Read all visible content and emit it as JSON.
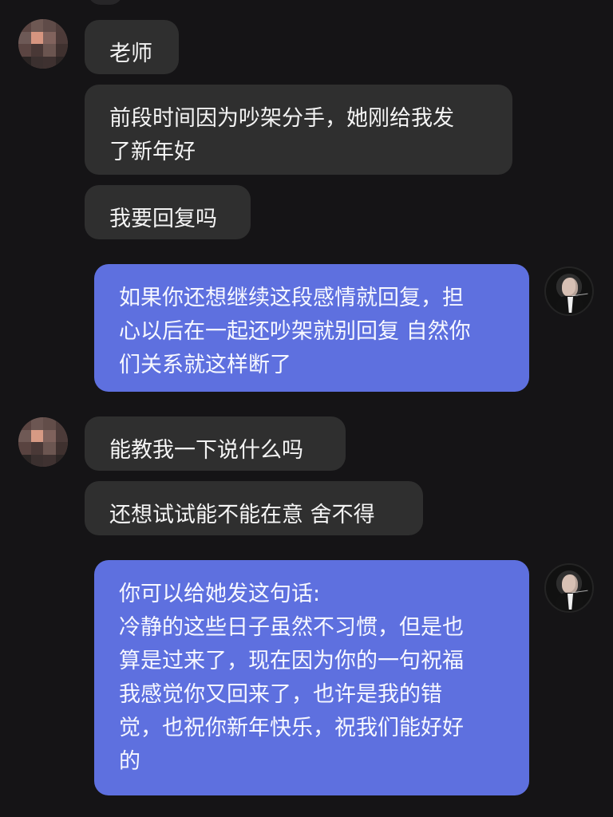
{
  "messages": [
    {
      "side": "incoming",
      "text": "老师"
    },
    {
      "side": "incoming",
      "text": "前段时间因为吵架分手，她刚给我发\n了新年好"
    },
    {
      "side": "incoming",
      "text": "我要回复吗"
    },
    {
      "side": "outgoing",
      "text": "如果你还想继续这段感情就回复，担\n心以后在一起还吵架就别回复 自然你\n们关系就这样断了"
    },
    {
      "side": "incoming",
      "text": "能教我一下说什么吗"
    },
    {
      "side": "incoming",
      "text": "还想试试能不能在意 舍不得"
    },
    {
      "side": "outgoing",
      "text": "你可以给她发这句话:\n冷静的这些日子虽然不习惯，但是也\n算是过来了，现在因为你的一句祝福\n我感觉你又回来了，也许是我的错\n觉，也祝你新年快乐，祝我们能好好\n的"
    }
  ],
  "avatars": {
    "incoming": "pixelated-user-avatar",
    "outgoing": "teacher-avatar"
  },
  "colors": {
    "background": "#151416",
    "incoming_bubble": "#2f2f2f",
    "outgoing_bubble": "#5e70df",
    "text": "#f4f4f4"
  }
}
